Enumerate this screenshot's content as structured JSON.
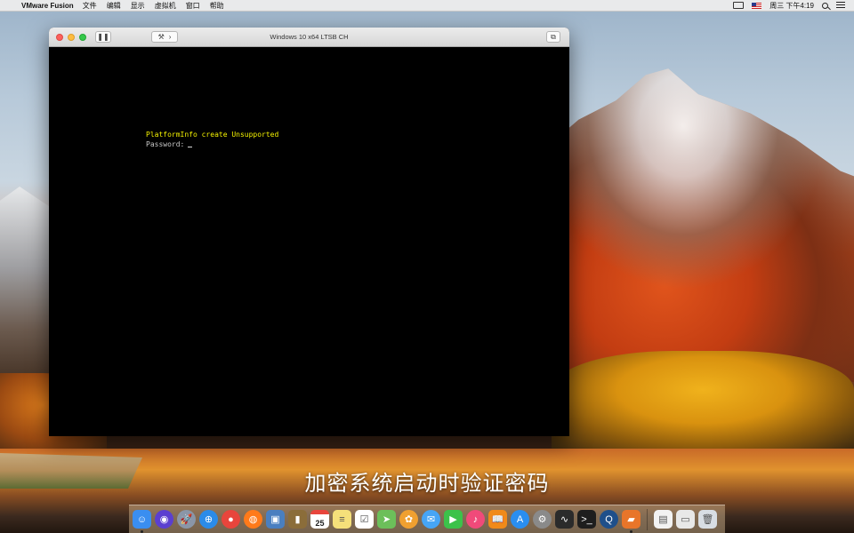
{
  "menubar": {
    "app_name": "VMware Fusion",
    "items": [
      "文件",
      "编辑",
      "显示",
      "虚拟机",
      "窗口",
      "帮助"
    ],
    "clock": "周三 下午4:19"
  },
  "vm_window": {
    "title": "Windows 10 x64 LTSB CH",
    "console": {
      "line1": "PlatformInfo create Unsupported",
      "line2": "Password:"
    }
  },
  "caption": "加密系统启动时验证密码",
  "dock": {
    "calendar_day": "25",
    "apps": [
      {
        "icon": "finder-icon",
        "color": "#3a8ef0",
        "running": true
      },
      {
        "icon": "siri-icon",
        "color": "#5b3fd0",
        "running": false
      },
      {
        "icon": "launchpad-icon",
        "color": "#8a96a8",
        "running": false
      },
      {
        "icon": "safari-icon",
        "color": "#2b8be8",
        "running": false
      },
      {
        "icon": "chrome-icon",
        "color": "#e8453c",
        "running": false
      },
      {
        "icon": "firefox-icon",
        "color": "#ff7a1a",
        "running": false
      },
      {
        "icon": "preview-icon",
        "color": "#4a7fc0",
        "running": false
      },
      {
        "icon": "notebook-icon",
        "color": "#8b6d3a",
        "running": false
      },
      {
        "icon": "calendar-icon",
        "color": "#ffffff",
        "running": false
      },
      {
        "icon": "notes-icon",
        "color": "#f5e07a",
        "running": false
      },
      {
        "icon": "reminders-icon",
        "color": "#ffffff",
        "running": false
      },
      {
        "icon": "maps-icon",
        "color": "#6cbf5a",
        "running": false
      },
      {
        "icon": "photos-icon",
        "color": "#f0a030",
        "running": false
      },
      {
        "icon": "messages-icon",
        "color": "#46a5f5",
        "running": false
      },
      {
        "icon": "facetime-icon",
        "color": "#3cc24a",
        "running": false
      },
      {
        "icon": "music-icon",
        "color": "#f04a7a",
        "running": false
      },
      {
        "icon": "books-icon",
        "color": "#f08a1a",
        "running": false
      },
      {
        "icon": "app-store-icon",
        "color": "#2a8ef0",
        "running": false
      },
      {
        "icon": "system-preferences-icon",
        "color": "#8a8a8a",
        "running": false
      },
      {
        "icon": "activity-monitor-icon",
        "color": "#2b2b2b",
        "running": false
      },
      {
        "icon": "terminal-icon",
        "color": "#1e1e1e",
        "running": false
      },
      {
        "icon": "quicktime-icon",
        "color": "#1f4f8a",
        "running": false
      },
      {
        "icon": "vmware-fusion-icon",
        "color": "#e8752a",
        "running": true
      }
    ],
    "stacks": [
      {
        "icon": "document-icon",
        "color": "#f2f2f2"
      },
      {
        "icon": "folder-stack-icon",
        "color": "#e8e8e8"
      },
      {
        "icon": "trash-icon",
        "color": "#d8dde3"
      }
    ]
  }
}
